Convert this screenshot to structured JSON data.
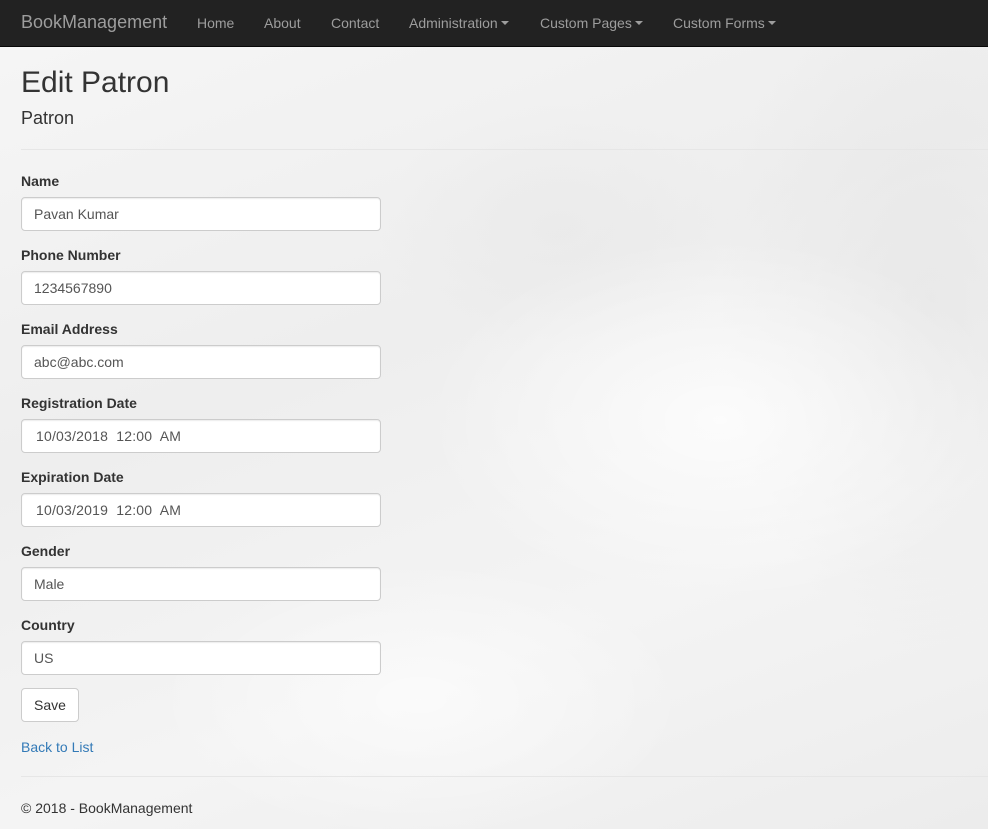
{
  "navbar": {
    "brand": "BookManagement",
    "items": [
      {
        "label": "Home"
      },
      {
        "label": "About"
      },
      {
        "label": "Contact"
      },
      {
        "label": "Administration"
      },
      {
        "label": "Custom Pages"
      },
      {
        "label": "Custom Forms"
      }
    ]
  },
  "page": {
    "title": "Edit Patron",
    "subtitle": "Patron"
  },
  "form": {
    "name": {
      "label": "Name",
      "value": "Pavan Kumar"
    },
    "phone": {
      "label": "Phone Number",
      "value": "1234567890"
    },
    "email": {
      "label": "Email Address",
      "value": "abc@abc.com"
    },
    "registration": {
      "label": "Registration Date",
      "value": "10/03/2018  12:00  AM"
    },
    "expiration": {
      "label": "Expiration Date",
      "value": "10/03/2019  12:00  AM"
    },
    "gender": {
      "label": "Gender",
      "value": "Male"
    },
    "country": {
      "label": "Country",
      "value": "US"
    },
    "save_label": "Save"
  },
  "links": {
    "back": "Back to List"
  },
  "footer": {
    "text": "© 2018 - BookManagement"
  }
}
